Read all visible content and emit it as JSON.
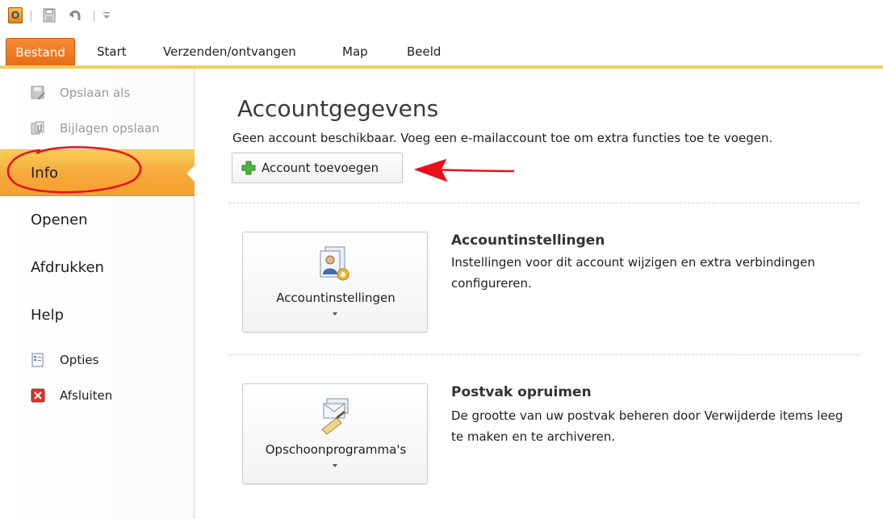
{
  "quick_access": {
    "app_logo_letter": "O",
    "icons": [
      "outlook-icon",
      "save-icon",
      "undo-icon",
      "customize-icon"
    ]
  },
  "tabs": {
    "file": "Bestand",
    "start": "Start",
    "send_receive": "Verzenden/ontvangen",
    "folder": "Map",
    "view": "Beeld"
  },
  "sidebar": {
    "save_as": "Opslaan als",
    "save_attachments": "Bijlagen opslaan",
    "info": "Info",
    "open": "Openen",
    "print": "Afdrukken",
    "help": "Help",
    "options": "Opties",
    "exit": "Afsluiten"
  },
  "main": {
    "title": "Accountgegevens",
    "subtitle": "Geen account beschikbaar. Voeg een e-mailaccount toe om extra functies toe te voegen.",
    "add_account_label": "Account toevoegen",
    "account_settings": {
      "button_label": "Accountinstellingen",
      "heading": "Accountinstellingen",
      "description": "Instellingen voor dit account wijzigen en extra verbindingen configureren."
    },
    "cleanup": {
      "button_label": "Opschoonprogramma's",
      "heading": "Postvak opruimen",
      "description": "De grootte van uw postvak beheren door Verwijderde items leeg te maken en te archiveren."
    }
  },
  "colors": {
    "file_tab": "#e56f15",
    "active_item": "#f6a83a",
    "tab_underline": "#f2c449",
    "annotation": "#e8101a"
  }
}
